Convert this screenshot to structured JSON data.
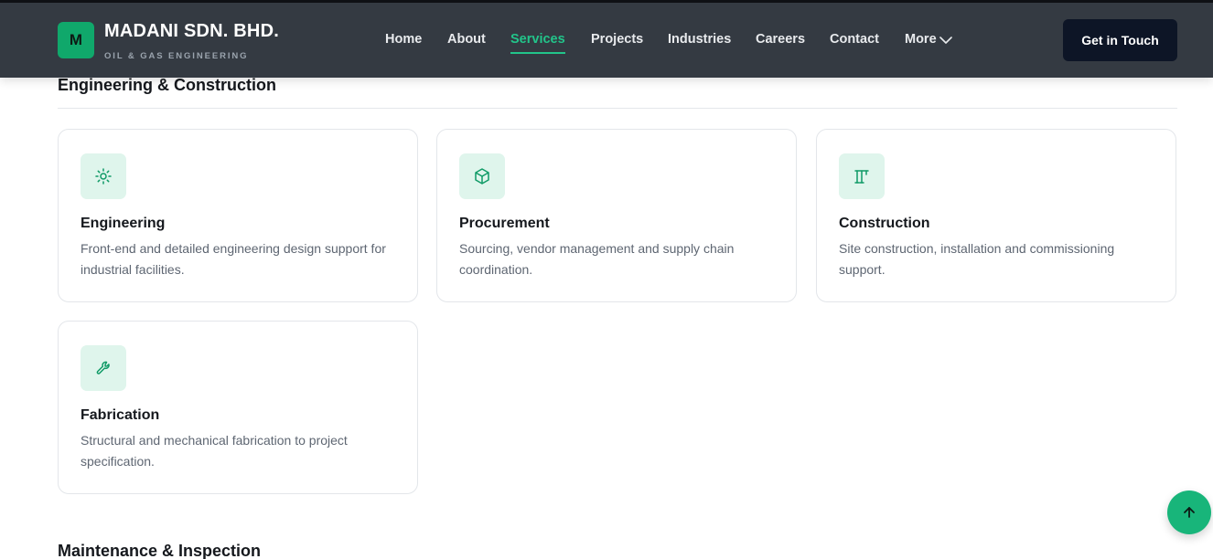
{
  "header": {
    "logo_letter": "M",
    "brand_name": "MADANI SDN. BHD.",
    "brand_tagline": "OIL & GAS ENGINEERING",
    "nav": [
      {
        "label": "Home"
      },
      {
        "label": "About"
      },
      {
        "label": "Services",
        "active": true
      },
      {
        "label": "Projects"
      },
      {
        "label": "Industries"
      },
      {
        "label": "Careers"
      },
      {
        "label": "Contact"
      },
      {
        "label": "More"
      }
    ],
    "cta_label": "Get in Touch"
  },
  "sections": [
    {
      "title": "Engineering & Construction",
      "cards": [
        {
          "icon": "sun-icon",
          "title": "Engineering",
          "description": "Front-end and detailed engineering design support for industrial facilities."
        },
        {
          "icon": "box-icon",
          "title": "Procurement",
          "description": "Sourcing, vendor management and supply chain coordination."
        },
        {
          "icon": "crane-icon",
          "title": "Construction",
          "description": "Site construction, installation and commissioning support."
        },
        {
          "icon": "wrench-icon",
          "title": "Fabrication",
          "description": "Structural and mechanical fabrication to project specification."
        }
      ]
    },
    {
      "title": "Maintenance & Inspection"
    }
  ],
  "scroll_top_icon": "arrow-up-icon",
  "colors": {
    "accent": "#22c48a",
    "nav_bg": "#343a42",
    "cta_bg": "#0d1526",
    "icon_bg": "#dff5ec",
    "icon_stroke": "#0f9a66"
  }
}
